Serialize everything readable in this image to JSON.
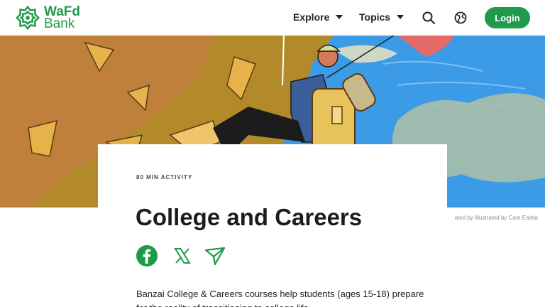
{
  "brand": {
    "line1": "WaFd",
    "line2": "Bank",
    "color": "#1f9a4a"
  },
  "nav": {
    "explore": "Explore",
    "topics": "Topics",
    "search_icon": "search-icon",
    "globe_icon": "globe-icon",
    "login": "Login"
  },
  "hero": {
    "caption": "ated by Illustrated by Cam Estela"
  },
  "article": {
    "kicker": "80 MIN ACTIVITY",
    "title": "College and Careers",
    "share_icons": [
      "facebook-icon",
      "x-icon",
      "send-icon"
    ],
    "body": "Banzai College & Careers courses help students (ages 15-18) prepare for the reality of transitioning to college life."
  },
  "colors": {
    "accent": "#1f9a4a",
    "sky": "#3c9be6",
    "rock": "#b38a2a"
  }
}
